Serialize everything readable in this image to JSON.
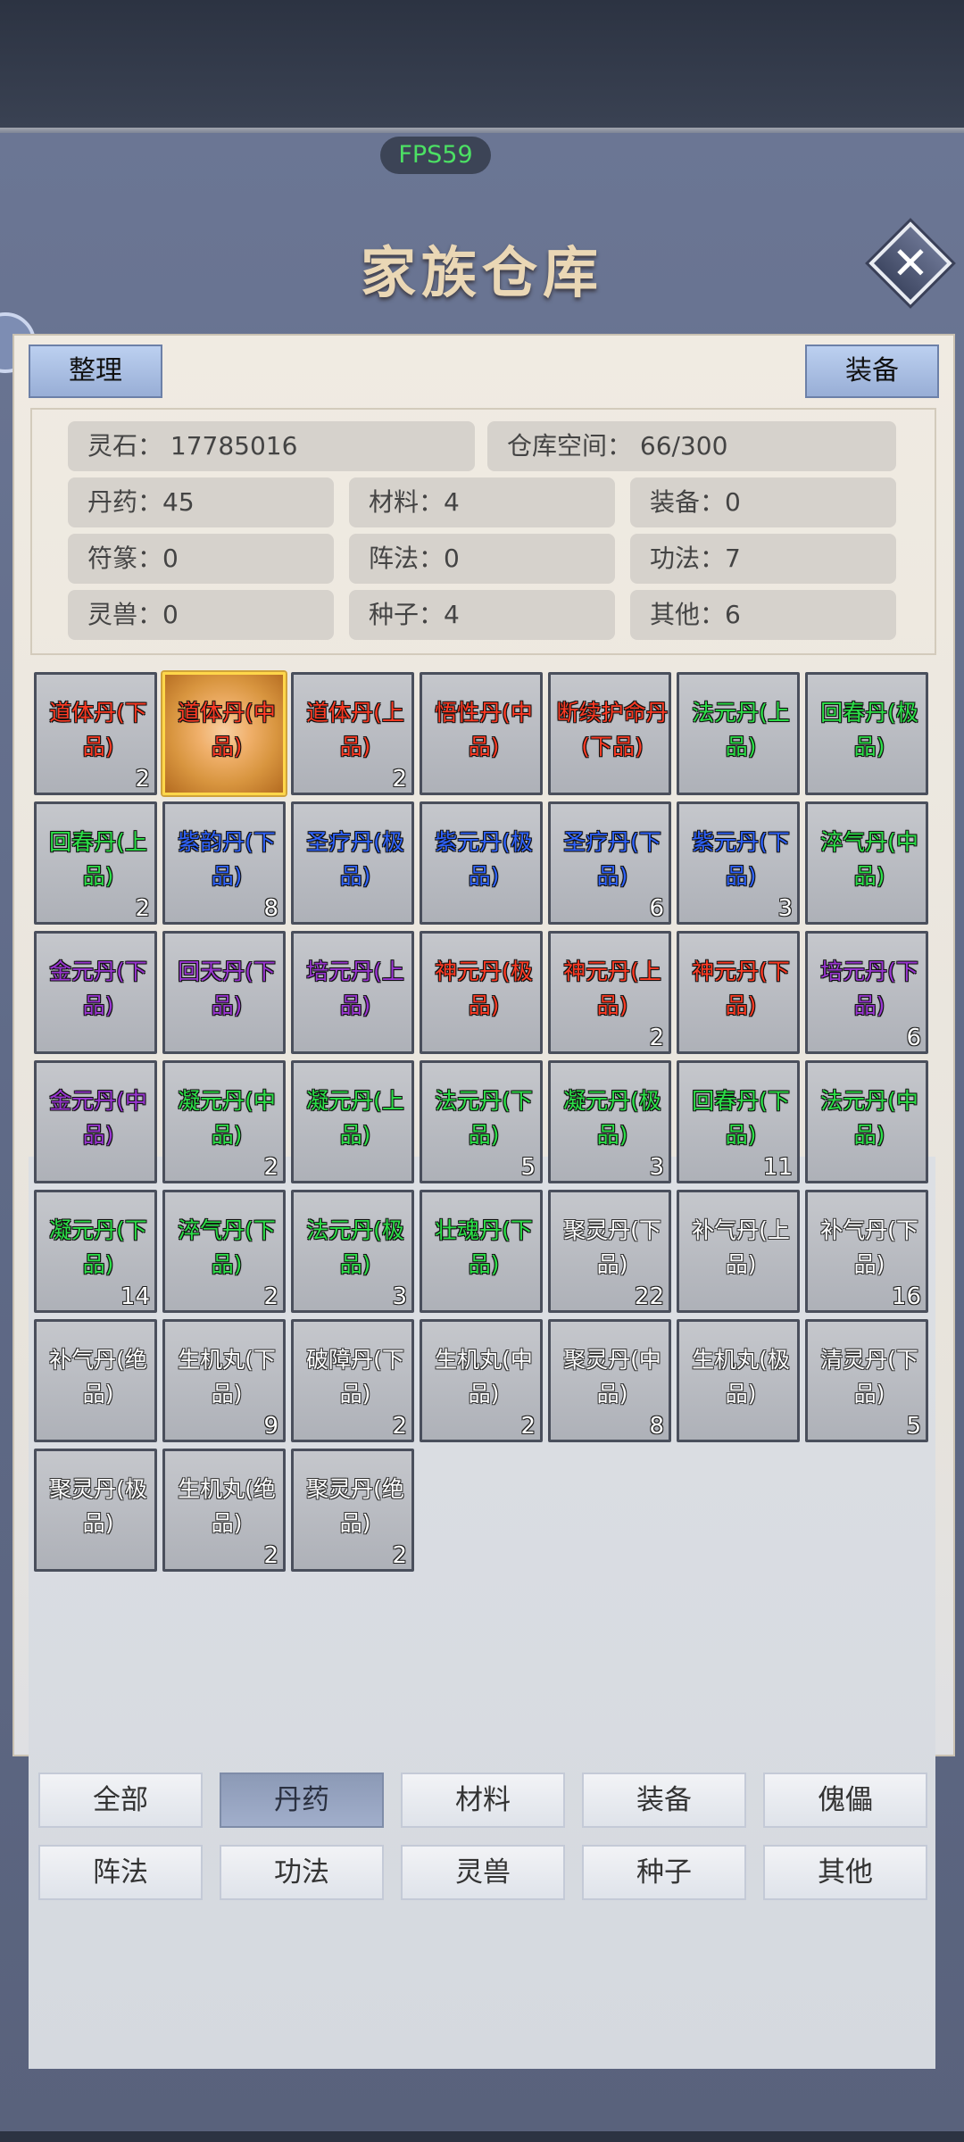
{
  "header": {
    "fps": "FPS59",
    "title": "家族仓库"
  },
  "toolbar": {
    "sort_label": "整理",
    "equip_label": "装备"
  },
  "stats": {
    "spirit_stone": "灵石：  17785016",
    "storage_space": "仓库空间：    66/300",
    "pills": "丹药：45",
    "materials": "材料：4",
    "equipment": "装备：0",
    "talismans": "符篆：0",
    "formations": "阵法：0",
    "techniques": "功法：7",
    "beasts": "灵兽：0",
    "seeds": "种子：4",
    "others": "其他：6"
  },
  "items": [
    {
      "name": "道体丹(下品)",
      "count": "2",
      "color": "red"
    },
    {
      "name": "道体丹(中品)",
      "count": "",
      "color": "red",
      "selected": true
    },
    {
      "name": "道体丹(上品)",
      "count": "2",
      "color": "red"
    },
    {
      "name": "悟性丹(中品)",
      "count": "",
      "color": "red"
    },
    {
      "name": "断续护命丹(下品)",
      "count": "",
      "color": "red"
    },
    {
      "name": "法元丹(上品)",
      "count": "",
      "color": "green"
    },
    {
      "name": "回春丹(极品)",
      "count": "",
      "color": "green"
    },
    {
      "name": "回春丹(上品)",
      "count": "2",
      "color": "green"
    },
    {
      "name": "紫韵丹(下品)",
      "count": "8",
      "color": "blue"
    },
    {
      "name": "圣疗丹(极品)",
      "count": "",
      "color": "blue"
    },
    {
      "name": "紫元丹(极品)",
      "count": "",
      "color": "blue"
    },
    {
      "name": "圣疗丹(下品)",
      "count": "6",
      "color": "blue"
    },
    {
      "name": "紫元丹(下品)",
      "count": "3",
      "color": "blue"
    },
    {
      "name": "淬气丹(中品)",
      "count": "",
      "color": "green"
    },
    {
      "name": "金元丹(下品)",
      "count": "",
      "color": "purple"
    },
    {
      "name": "回天丹(下品)",
      "count": "",
      "color": "purple"
    },
    {
      "name": "培元丹(上品)",
      "count": "",
      "color": "purple"
    },
    {
      "name": "神元丹(极品)",
      "count": "",
      "color": "red"
    },
    {
      "name": "神元丹(上品)",
      "count": "2",
      "color": "red"
    },
    {
      "name": "神元丹(下品)",
      "count": "",
      "color": "red"
    },
    {
      "name": "培元丹(下品)",
      "count": "6",
      "color": "purple"
    },
    {
      "name": "金元丹(中品)",
      "count": "",
      "color": "purple"
    },
    {
      "name": "凝元丹(中品)",
      "count": "2",
      "color": "green"
    },
    {
      "name": "凝元丹(上品)",
      "count": "",
      "color": "green"
    },
    {
      "name": "法元丹(下品)",
      "count": "5",
      "color": "green"
    },
    {
      "name": "凝元丹(极品)",
      "count": "3",
      "color": "green"
    },
    {
      "name": "回春丹(下品)",
      "count": "11",
      "color": "green"
    },
    {
      "name": "法元丹(中品)",
      "count": "",
      "color": "green"
    },
    {
      "name": "凝元丹(下品)",
      "count": "14",
      "color": "green"
    },
    {
      "name": "淬气丹(下品)",
      "count": "2",
      "color": "green"
    },
    {
      "name": "法元丹(极品)",
      "count": "3",
      "color": "green"
    },
    {
      "name": "壮魂丹(下品)",
      "count": "",
      "color": "green"
    },
    {
      "name": "聚灵丹(下品)",
      "count": "22",
      "color": "white"
    },
    {
      "name": "补气丹(上品)",
      "count": "",
      "color": "white"
    },
    {
      "name": "补气丹(下品)",
      "count": "16",
      "color": "white"
    },
    {
      "name": "补气丹(绝品)",
      "count": "",
      "color": "white"
    },
    {
      "name": "生机丸(下品)",
      "count": "9",
      "color": "white"
    },
    {
      "name": "破障丹(下品)",
      "count": "2",
      "color": "white"
    },
    {
      "name": "生机丸(中品)",
      "count": "2",
      "color": "white"
    },
    {
      "name": "聚灵丹(中品)",
      "count": "8",
      "color": "white"
    },
    {
      "name": "生机丸(极品)",
      "count": "",
      "color": "white"
    },
    {
      "name": "清灵丹(下品)",
      "count": "5",
      "color": "white"
    },
    {
      "name": "聚灵丹(极品)",
      "count": "",
      "color": "white"
    },
    {
      "name": "生机丸(绝品)",
      "count": "2",
      "color": "white"
    },
    {
      "name": "聚灵丹(绝品)",
      "count": "2",
      "color": "white"
    }
  ],
  "categories": [
    {
      "label": "全部"
    },
    {
      "label": "丹药",
      "active": true
    },
    {
      "label": "材料"
    },
    {
      "label": "装备"
    },
    {
      "label": "傀儡"
    },
    {
      "label": "阵法"
    },
    {
      "label": "功法"
    },
    {
      "label": "灵兽"
    },
    {
      "label": "种子"
    },
    {
      "label": "其他"
    }
  ]
}
